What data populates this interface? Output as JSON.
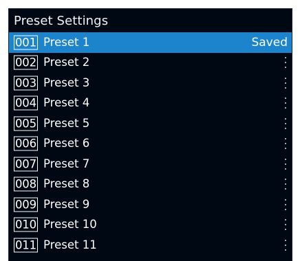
{
  "panel": {
    "title": "Preset Settings"
  },
  "presets": [
    {
      "number": "001",
      "name": "Preset 1",
      "status": "Saved",
      "selected": true,
      "menu_icon": "kebab-menu-icon"
    },
    {
      "number": "002",
      "name": "Preset 2",
      "status": "",
      "selected": false,
      "menu_icon": "kebab-menu-icon"
    },
    {
      "number": "003",
      "name": "Preset 3",
      "status": "",
      "selected": false,
      "menu_icon": "kebab-menu-icon"
    },
    {
      "number": "004",
      "name": "Preset 4",
      "status": "",
      "selected": false,
      "menu_icon": "kebab-menu-icon"
    },
    {
      "number": "005",
      "name": "Preset 5",
      "status": "",
      "selected": false,
      "menu_icon": "kebab-menu-icon"
    },
    {
      "number": "006",
      "name": "Preset 6",
      "status": "",
      "selected": false,
      "menu_icon": "kebab-menu-icon"
    },
    {
      "number": "007",
      "name": "Preset 7",
      "status": "",
      "selected": false,
      "menu_icon": "kebab-menu-icon"
    },
    {
      "number": "008",
      "name": "Preset 8",
      "status": "",
      "selected": false,
      "menu_icon": "kebab-menu-icon"
    },
    {
      "number": "009",
      "name": "Preset 9",
      "status": "",
      "selected": false,
      "menu_icon": "kebab-menu-icon"
    },
    {
      "number": "010",
      "name": "Preset 10",
      "status": "",
      "selected": false,
      "menu_icon": "kebab-menu-icon"
    },
    {
      "number": "011",
      "name": "Preset 11",
      "status": "",
      "selected": false,
      "menu_icon": "kebab-menu-icon"
    }
  ],
  "colors": {
    "background": "#000814",
    "selected_row": "#1b84cc",
    "text": "#ffffff"
  }
}
